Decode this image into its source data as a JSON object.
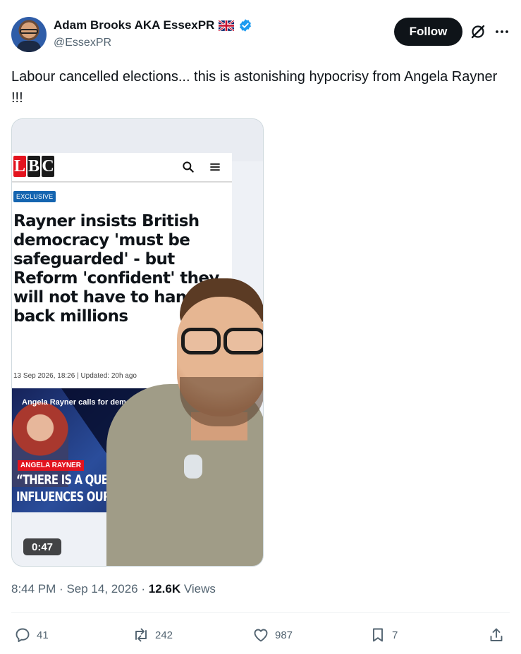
{
  "author": {
    "display_name": "Adam Brooks AKA EssexPR",
    "handle": "@EssexPR"
  },
  "header": {
    "follow_label": "Follow"
  },
  "tweet": {
    "text": "Labour cancelled elections... this is astonishing hypocrisy from Angela Rayner !!!"
  },
  "media": {
    "article": {
      "logo_letters": [
        "L",
        "B",
        "C"
      ],
      "badge": "EXCLUSIVE",
      "headline": "Rayner insists British democracy 'must be safeguarded' - but Reform 'confident' they will not have to hand back millions",
      "meta": "13 Sep 2026, 18:26 | Updated: 20h ago",
      "video_caption": "Angela Rayner calls for democracy to",
      "name_tag": "ANGELA RAYNER",
      "quote_line1": "“THERE IS A QUESTI",
      "quote_line2": "INFLUENCES OUR D"
    },
    "duration": "0:47"
  },
  "meta": {
    "time": "8:44 PM",
    "separator": "·",
    "date": "Sep 14, 2026",
    "views_count": "12.6K",
    "views_label": "Views"
  },
  "actions": {
    "replies": "41",
    "reposts": "242",
    "likes": "987",
    "bookmarks": "7"
  },
  "colors": {
    "text_primary": "#0f1419",
    "text_secondary": "#536471",
    "verified_blue": "#1d9bf0",
    "border": "#cfd9de"
  }
}
